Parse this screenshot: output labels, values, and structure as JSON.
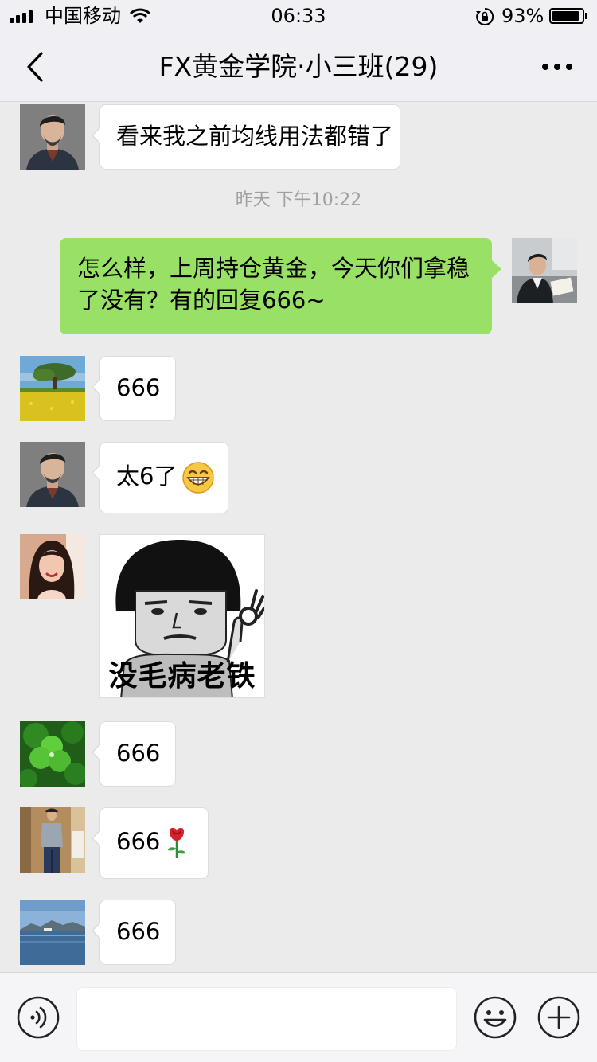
{
  "status_bar": {
    "carrier": "中国移动",
    "time": "06:33",
    "battery_percent": "93%",
    "battery_level": 0.93
  },
  "nav": {
    "title": "FX黄金学院·小三班(29)"
  },
  "messages": [
    {
      "type": "text",
      "direction": "incoming",
      "avatar": "man-grey-portrait",
      "text": "看来我之前均线用法都错了"
    },
    {
      "type": "timestamp",
      "text": "昨天 下午10:22"
    },
    {
      "type": "text",
      "direction": "outgoing",
      "avatar": "man-reading-photo",
      "text": "怎么样，上周持仓黄金，今天你们拿稳了没有？有的回复666~"
    },
    {
      "type": "text",
      "direction": "incoming",
      "avatar": "tree-field-landscape",
      "text": "666"
    },
    {
      "type": "text",
      "direction": "incoming",
      "avatar": "man-grey-portrait",
      "text": "太6了",
      "emoji": "grin-emoji"
    },
    {
      "type": "sticker",
      "direction": "incoming",
      "avatar": "woman-selfie",
      "caption": "没毛病老铁"
    },
    {
      "type": "text",
      "direction": "incoming",
      "avatar": "clover-leaf",
      "text": "666"
    },
    {
      "type": "text",
      "direction": "incoming",
      "avatar": "man-standing-photo",
      "text": "666",
      "emoji": "rose-emoji"
    },
    {
      "type": "text",
      "direction": "incoming",
      "avatar": "sea-skyline",
      "text": "666"
    }
  ],
  "input_bar": {
    "icons": [
      "voice-icon",
      "emoji-icon",
      "plus-icon"
    ]
  }
}
